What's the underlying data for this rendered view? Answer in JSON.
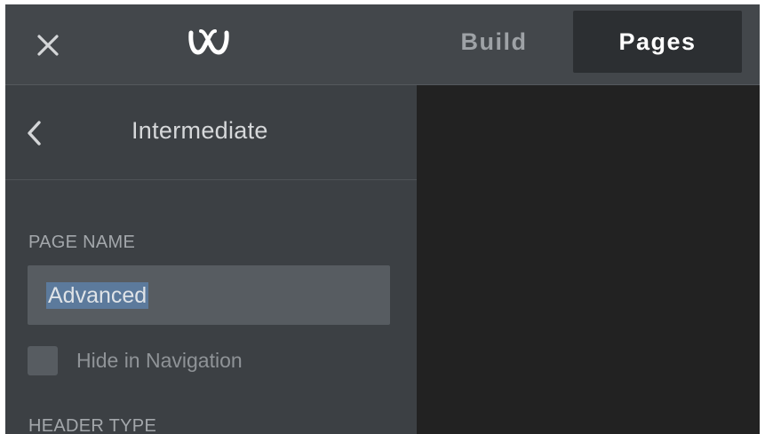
{
  "topbar": {
    "close_icon": "close-icon",
    "logo_icon": "weebly-logo-icon",
    "tabs": [
      {
        "label": "Build",
        "active": false
      },
      {
        "label": "Pages",
        "active": true
      }
    ]
  },
  "sidebar": {
    "back_icon": "chevron-left-icon",
    "title": "Intermediate",
    "page_name_label": "PAGE NAME",
    "page_name_value": "Advanced",
    "hide_in_navigation_label": "Hide in Navigation",
    "hide_in_navigation_checked": false,
    "header_type_label": "HEADER TYPE"
  },
  "colors": {
    "topbar_bg": "#43474b",
    "sidebar_bg": "#3c4044",
    "canvas_bg": "#222222",
    "active_tab_bg": "#2c2f32",
    "selection": "#5c7a9c"
  }
}
